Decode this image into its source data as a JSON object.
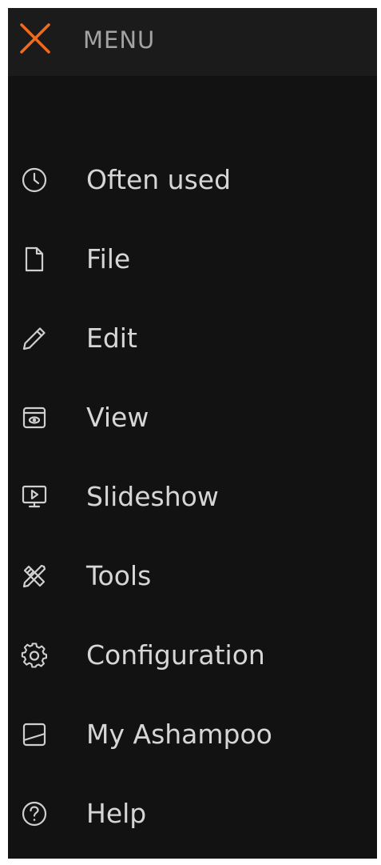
{
  "header": {
    "title": "MENU",
    "close_icon": "close-icon",
    "accent_color": "#f26b1d"
  },
  "menu": {
    "items": [
      {
        "label": "Often used",
        "icon": "clock-icon"
      },
      {
        "label": "File",
        "icon": "file-icon"
      },
      {
        "label": "Edit",
        "icon": "pencil-icon"
      },
      {
        "label": "View",
        "icon": "view-icon"
      },
      {
        "label": "Slideshow",
        "icon": "slideshow-icon"
      },
      {
        "label": "Tools",
        "icon": "tools-icon"
      },
      {
        "label": "Configuration",
        "icon": "gear-icon"
      },
      {
        "label": "My Ashampoo",
        "icon": "ashampoo-icon"
      },
      {
        "label": "Help",
        "icon": "help-icon"
      }
    ]
  }
}
